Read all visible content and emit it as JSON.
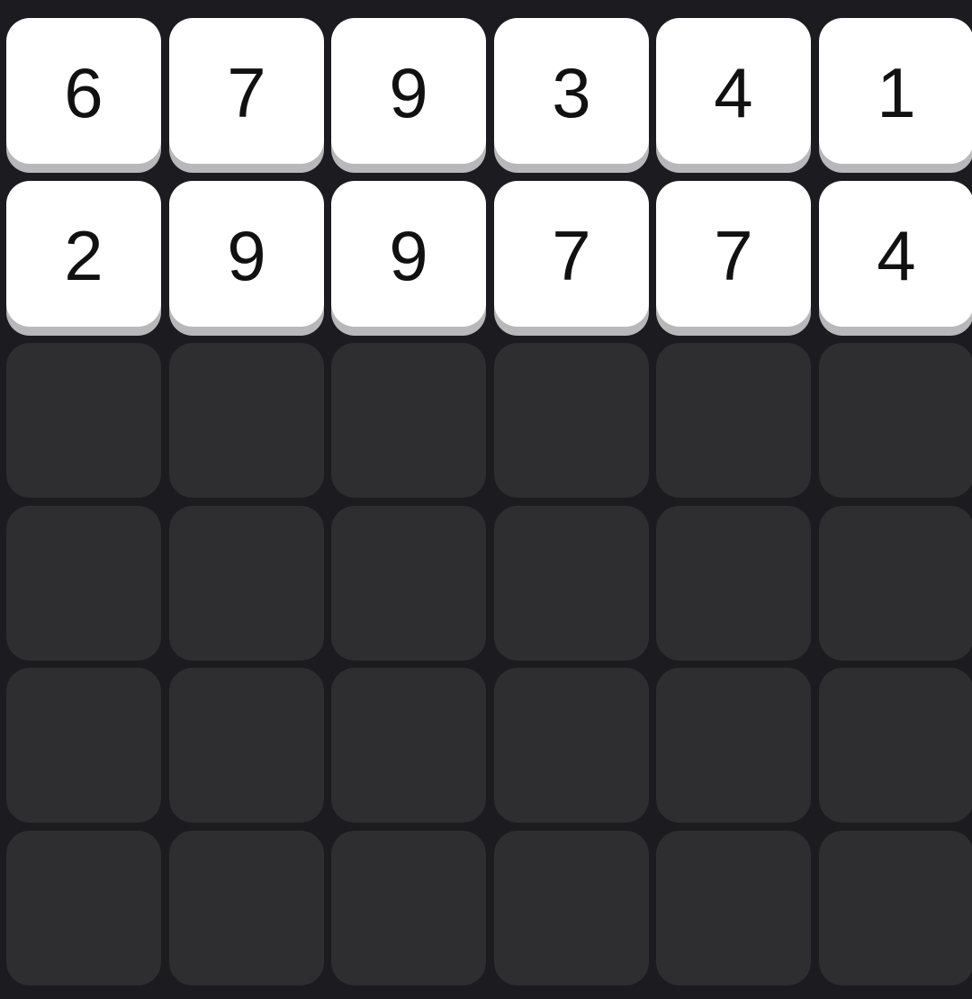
{
  "board": {
    "rows": [
      [
        "6",
        "7",
        "9",
        "3",
        "4",
        "1"
      ],
      [
        "2",
        "9",
        "9",
        "7",
        "7",
        "4"
      ],
      [
        "",
        "",
        "",
        "",
        "",
        ""
      ],
      [
        "",
        "",
        "",
        "",
        "",
        ""
      ],
      [
        "",
        "",
        "",
        "",
        "",
        ""
      ],
      [
        "",
        "",
        "",
        "",
        "",
        ""
      ]
    ]
  },
  "colors": {
    "background": "#1c1b1f",
    "empty_tile": "#2e2e30",
    "filled_tile": "#ffffff",
    "tile_shadow": "#b8b7b9",
    "digit": "#111111"
  }
}
